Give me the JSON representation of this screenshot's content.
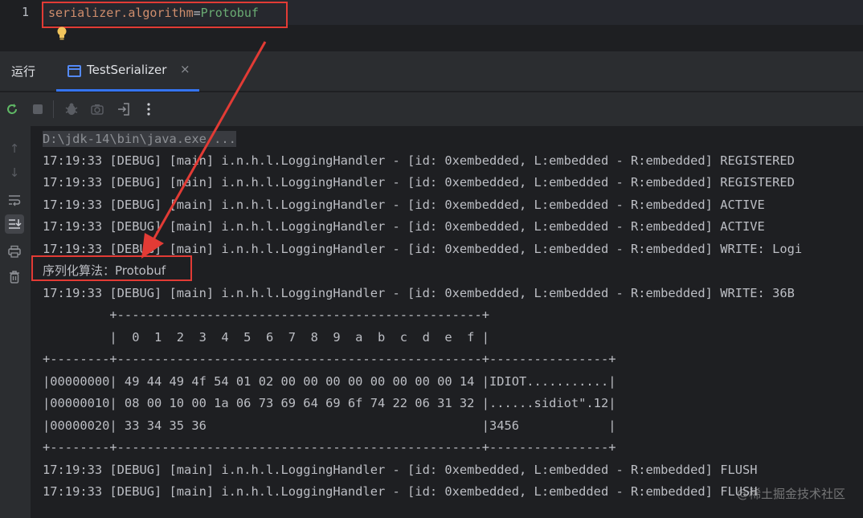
{
  "editor": {
    "line_number": "1",
    "code_key": "serializer.algorithm",
    "code_eq": "=",
    "code_value": "Protobuf"
  },
  "tool_window": {
    "title": "运行",
    "tab_label": "TestSerializer",
    "tab_close": "×"
  },
  "toolbar": {
    "icons": [
      "rerun-icon",
      "stop-icon",
      "debug-icon",
      "camera-icon",
      "login-icon",
      "more-icon"
    ]
  },
  "rail": {
    "icons": [
      "up-arrow-icon",
      "down-arrow-icon",
      "soft-wrap-icon",
      "scroll-to-end-icon",
      "print-icon",
      "trash-icon"
    ]
  },
  "console": {
    "lines": [
      "D:\\jdk-14\\bin\\java.exe ...",
      "17:19:33 [DEBUG] [main] i.n.h.l.LoggingHandler - [id: 0xembedded, L:embedded - R:embedded] REGISTERED",
      "17:19:33 [DEBUG] [main] i.n.h.l.LoggingHandler - [id: 0xembedded, L:embedded - R:embedded] REGISTERED",
      "17:19:33 [DEBUG] [main] i.n.h.l.LoggingHandler - [id: 0xembedded, L:embedded - R:embedded] ACTIVE",
      "17:19:33 [DEBUG] [main] i.n.h.l.LoggingHandler - [id: 0xembedded, L:embedded - R:embedded] ACTIVE",
      "17:19:33 [DEBUG] [main] i.n.h.l.LoggingHandler - [id: 0xembedded, L:embedded - R:embedded] WRITE: Logi",
      "序列化算法：Protobuf",
      "17:19:33 [DEBUG] [main] i.n.h.l.LoggingHandler - [id: 0xembedded, L:embedded - R:embedded] WRITE: 36B",
      "         +-------------------------------------------------+",
      "         |  0  1  2  3  4  5  6  7  8  9  a  b  c  d  e  f |",
      "+--------+-------------------------------------------------+----------------+",
      "|00000000| 49 44 49 4f 54 01 02 00 00 00 00 00 00 00 00 14 |IDIOT...........|",
      "|00000010| 08 00 10 00 1a 06 73 69 64 69 6f 74 22 06 31 32 |......sidiot\".12|",
      "|00000020| 33 34 35 36                                     |3456            |",
      "+--------+-------------------------------------------------+----------------+",
      "17:19:33 [DEBUG] [main] i.n.h.l.LoggingHandler - [id: 0xembedded, L:embedded - R:embedded] FLUSH",
      "17:19:33 [DEBUG] [main] i.n.h.l.LoggingHandler - [id: 0xembedded, L:embedded - R:embedded] FLUSH"
    ]
  },
  "watermark": "@稀土掘金技术社区"
}
